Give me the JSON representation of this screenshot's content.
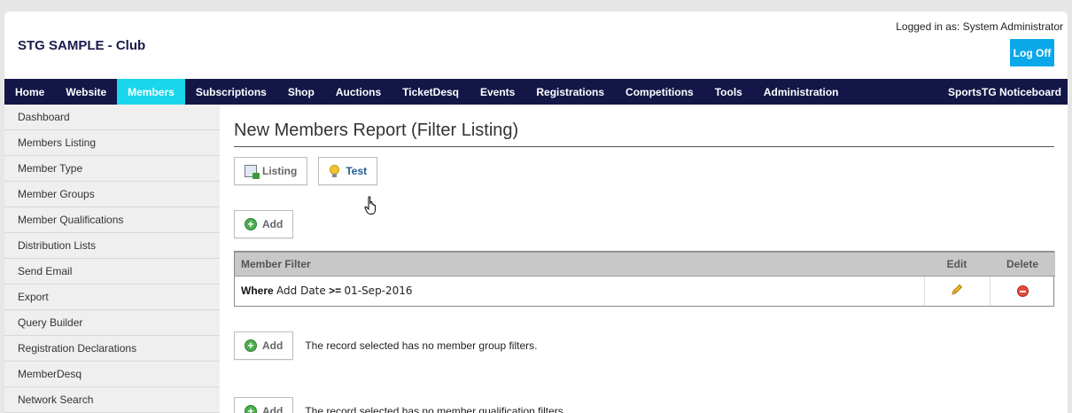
{
  "header": {
    "club_name": "STG SAMPLE - Club",
    "logged_in_text": "Logged in as: System Administrator",
    "logoff_label": "Log Off"
  },
  "nav": {
    "items": [
      "Home",
      "Website",
      "Members",
      "Subscriptions",
      "Shop",
      "Auctions",
      "TicketDesq",
      "Events",
      "Registrations",
      "Competitions",
      "Tools",
      "Administration"
    ],
    "active": "Members",
    "right_item": "SportsTG Noticeboard",
    "accent_color": "#1ad6ec",
    "bar_color": "#131647"
  },
  "sidebar": {
    "items": [
      "Dashboard",
      "Members Listing",
      "Member Type",
      "Member Groups",
      "Member Qualifications",
      "Distribution Lists",
      "Send Email",
      "Export",
      "Query Builder",
      "Registration Declarations",
      "MemberDesq",
      "Network Search"
    ]
  },
  "main": {
    "title": "New Members Report (Filter Listing)",
    "tabs": [
      {
        "label": "Listing",
        "icon": "listing-icon"
      },
      {
        "label": "Test",
        "icon": "lightbulb-icon"
      }
    ],
    "add_label": "Add",
    "filter_table": {
      "headers": [
        "Member Filter",
        "Edit",
        "Delete"
      ],
      "rows": [
        {
          "keyword": "Where",
          "field": "Add Date",
          "operator": ">=",
          "value": "01-Sep-2016"
        }
      ]
    },
    "group_note": "The record selected has no member group filters.",
    "qual_note": "The record selected has no member qualification filters."
  }
}
